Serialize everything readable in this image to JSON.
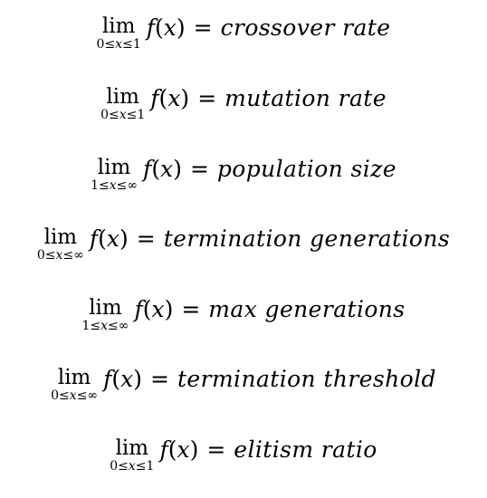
{
  "equations": [
    {
      "limit_label": "lim",
      "range": {
        "lower": "0",
        "rel1": "≤",
        "var": "x",
        "rel2": "≤",
        "upper": "1"
      },
      "function": "f",
      "variable": "x",
      "equals": "=",
      "parameter": "crossover rate"
    },
    {
      "limit_label": "lim",
      "range": {
        "lower": "0",
        "rel1": "≤",
        "var": "x",
        "rel2": "≤",
        "upper": "1"
      },
      "function": "f",
      "variable": "x",
      "equals": "=",
      "parameter": "mutation rate"
    },
    {
      "limit_label": "lim",
      "range": {
        "lower": "1",
        "rel1": "≤",
        "var": "x",
        "rel2": "≤",
        "upper": "∞"
      },
      "function": "f",
      "variable": "x",
      "equals": "=",
      "parameter": "population size"
    },
    {
      "limit_label": "lim",
      "range": {
        "lower": "0",
        "rel1": "≤",
        "var": "x",
        "rel2": "≤",
        "upper": "∞"
      },
      "function": "f",
      "variable": "x",
      "equals": "=",
      "parameter": "termination generations"
    },
    {
      "limit_label": "lim",
      "range": {
        "lower": "1",
        "rel1": "≤",
        "var": "x",
        "rel2": "≤",
        "upper": "∞"
      },
      "function": "f",
      "variable": "x",
      "equals": "=",
      "parameter": "max generations"
    },
    {
      "limit_label": "lim",
      "range": {
        "lower": "0",
        "rel1": "≤",
        "var": "x",
        "rel2": "≤",
        "upper": "∞"
      },
      "function": "f",
      "variable": "x",
      "equals": "=",
      "parameter": "termination threshold"
    },
    {
      "limit_label": "lim",
      "range": {
        "lower": "0",
        "rel1": "≤",
        "var": "x",
        "rel2": "≤",
        "upper": "1"
      },
      "function": "f",
      "variable": "x",
      "equals": "=",
      "parameter": "elitism ratio"
    }
  ],
  "colors": {
    "text": "#000000",
    "background": "#ffffff"
  }
}
